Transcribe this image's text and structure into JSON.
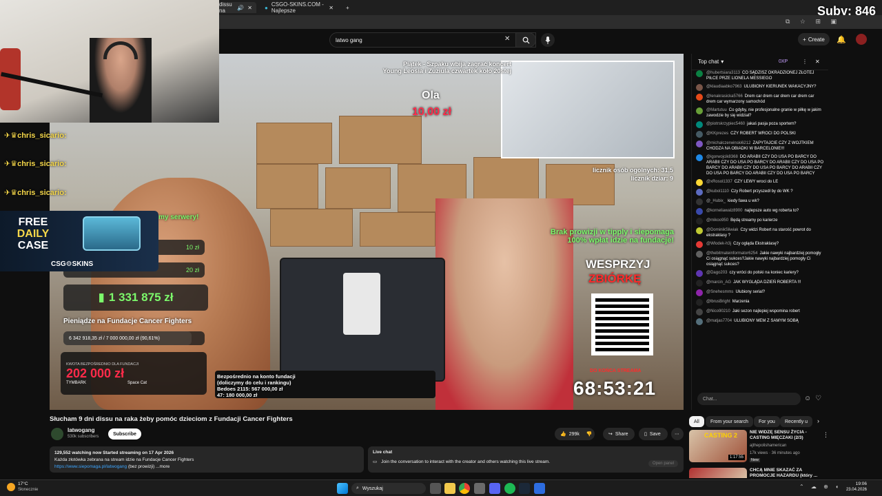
{
  "browser": {
    "tabs": [
      {
        "label": "dissu na"
      },
      {
        "label": "CSGO-SKINS.COM - Najlepsze"
      }
    ]
  },
  "header": {
    "search_value": "latwo gang",
    "create_label": "Create"
  },
  "overlay": {
    "suby": "Suby: 846",
    "chat_alerts": [
      "chris_sicario:",
      "chris_sicario:",
      "chris_sicario:"
    ],
    "free_case": [
      "FREE",
      "DAILY",
      "CASE"
    ],
    "csg_brand": "CSG⚙SKINS",
    "top_right_note": "Piątek - Szpaku wbija zagrać koncert\nYoung Leosia i Zuziula czwartek koło 20stej",
    "donor_name": "Ola",
    "donor_amount": "10,00 zł",
    "counter_lines": [
      "licznik osób ogolnych: 31,5",
      "licznik dziar: 9"
    ],
    "green_text": "Brak prowizji w tipply i siepomaga\n100% wpłat idzie na fundacje!",
    "support_title_1": "WESPRZYJ",
    "support_title_2": "ZBIÓRKĘ",
    "countdown_label": "DO KOŃCA STREAMA",
    "countdown": "68:53:21",
    "servers_text": "my serwery!",
    "small_amounts": [
      "10 zł",
      "20 zł"
    ],
    "total_raised": "1 331 875 zł",
    "fund_title": "Pieniądze na Fundacje Cancer Fighters",
    "fund_progress": "6 342 918,35 zł / 7 000 000,00 zł (90,61%)",
    "fund_progress_value": 0.9061,
    "direct_label": "KWOTA BEZPOŚREDNIO DLA FUNDACJI",
    "direct_amount": "202 000 zł",
    "direct_sponsors": [
      "TYMBARK",
      "Space Cat"
    ],
    "bottom_note": "Bezpośrednio na konto fundacji\n(doliczymy do celu i rankingu)\nBedoes 2115: 567 000,00 zł\n47: 180 000,00 zł"
  },
  "video": {
    "title": "Słucham 9 dni dissu na raka żeby pomóc dzieciom z Fundacji Cancer Fighters",
    "channel": "latwogang",
    "subscribers": "530k subscribers",
    "subscribe_label": "Subscribe",
    "likes": "299k",
    "share_label": "Share",
    "save_label": "Save",
    "stats": "129,552 watching now  Started streaming on 17 Apr 2026",
    "desc_line": "Każda złotówka zebrana na stream idzie na Fundacje Cancer Fighters",
    "desc_link": "https://www.siepomaga.pl/latwogang",
    "desc_rest": "(bez prowizji) ...more",
    "live_chat_title": "Live chat",
    "live_chat_text": "Join the conversation to interact with the creator and others watching this live stream.",
    "open_panel": "Open panel"
  },
  "chat": {
    "header": "Top chat",
    "badge": "0XP",
    "input_placeholder": "Chat...",
    "messages": [
      {
        "user": "@hubertsiara3113",
        "text": "CO SĄDZISZ OKRADZIONEJ ZŁOTEJ PIŁCE PRZE LIONELA MESSIEGO",
        "color": "#0b8043"
      },
      {
        "user": "@klaudiaabko7963",
        "text": "ULUBIONY KIERUNEK WAKACYJNY?",
        "color": "#795548"
      },
      {
        "user": "@lenakrasicka5766",
        "text": "Drem car drem car drem car drem car drem car wymarzony samochód",
        "color": "#e64a19"
      },
      {
        "user": "@Martutuu",
        "text": "Co gdyby, nie profesjonalne granie w piłkę w jakim zawodzie by się widział?",
        "color": "#689f38"
      },
      {
        "user": "@piotrskrzypiec5460",
        "text": "jakaś pasja poza sportem?",
        "color": "#00897b"
      },
      {
        "user": "@KKprezes",
        "text": "CZY ROBERT WROCI DO POLSKI",
        "color": "#455a64"
      },
      {
        "user": "@michalczerwinski6212",
        "text": "ZAPYTAJCIE CZY Z WOJTKIEM CHODZA NA OBIADKI W BARCELONIE!!!",
        "color": "#7e57c2"
      },
      {
        "user": "@igorwojcik8368",
        "text": "DO ARABII CZY DO USA PO BARCY DO ARABII CZY DO USA PO BARCY DO ARABII CZY DO USA PO BARCY DO ARABII CZY DO USA PO BARCY DO ARABII CZY DO USA PO BARCY DO ARABII CZY DO USA PO BARCY",
        "color": "#1e88e5"
      },
      {
        "user": "@xRosol1337",
        "text": "CZY LEWY wroci do LE",
        "color": "#fdd835"
      },
      {
        "user": "@kubol1110",
        "text": "Czy Robert przyszedł by do WK ?",
        "color": "#5c6bc0"
      },
      {
        "user": "@_Hubix_",
        "text": "kiedy fawa u wk?",
        "color": "#333333"
      },
      {
        "user": "@korneliawalz8900",
        "text": "najlepsze auto wg roberta to?",
        "color": "#3949ab"
      },
      {
        "user": "@mikoo950",
        "text": "Będą streamy po karierze",
        "color": "#222222"
      },
      {
        "user": "@DominikSliwiak",
        "text": "Czy widzi Robert na starość powrot do ekstraklasy ?",
        "color": "#c0ca33"
      },
      {
        "user": "@Wlodek-h3j",
        "text": "Czy ogląda Ekstraklasę?",
        "color": "#e53935"
      },
      {
        "user": "@thebitmateinformator6254",
        "text": "Jakie nawyki najbardziej pomogły Ci osiągnąć sukces?Jakie nawyki najbardziej pomogły Ci osiągnąć sukces?",
        "color": "#616161"
      },
      {
        "user": "@Dago203",
        "text": "czy wróci do polski na koniec kariery?",
        "color": "#5e35b1"
      },
      {
        "user": "@marcin_AG",
        "text": "JAK WYGLĄDA DZIEŃ ROBERTA !!!",
        "color": "#222222"
      },
      {
        "user": "@Snehesmms",
        "text": "Ulubiony serial?",
        "color": "#8e24aa"
      },
      {
        "user": "@lbrusBright",
        "text": "Marzenia",
        "color": "#222222"
      },
      {
        "user": "@Nico90210",
        "text": "Jaki sezon najlepiej wspomina robert",
        "color": "#444444"
      },
      {
        "user": "@matjas7704",
        "text": "ULUBIONY MEM Z SAMYM SOBĄ",
        "color": "#546e7a"
      }
    ]
  },
  "sidebar": {
    "chips": [
      "All",
      "From your search",
      "For you",
      "Recently u"
    ],
    "items": [
      {
        "title": "NIE WIDZĘ SENSU ŻYCIA - CASTING MIĘCZAKI (2/3)",
        "channel": "ajthepolishamerican",
        "meta": "17k views · 36 minutes ago",
        "badge": "New",
        "duration": "1:17:55",
        "thumb_label": "CASTING 2"
      },
      {
        "title": "CHCĄ MNIE SKAZAĆ ZA PROMOCJE HAZARDU (który ...",
        "channel": "",
        "meta": "",
        "badge": "",
        "duration": "",
        "thumb_label": ""
      }
    ]
  },
  "taskbar": {
    "weather_temp": "17°C",
    "weather_desc": "Słonecznie",
    "search_placeholder": "Wyszukaj",
    "time": "19:06",
    "date": "23.04.2026"
  }
}
